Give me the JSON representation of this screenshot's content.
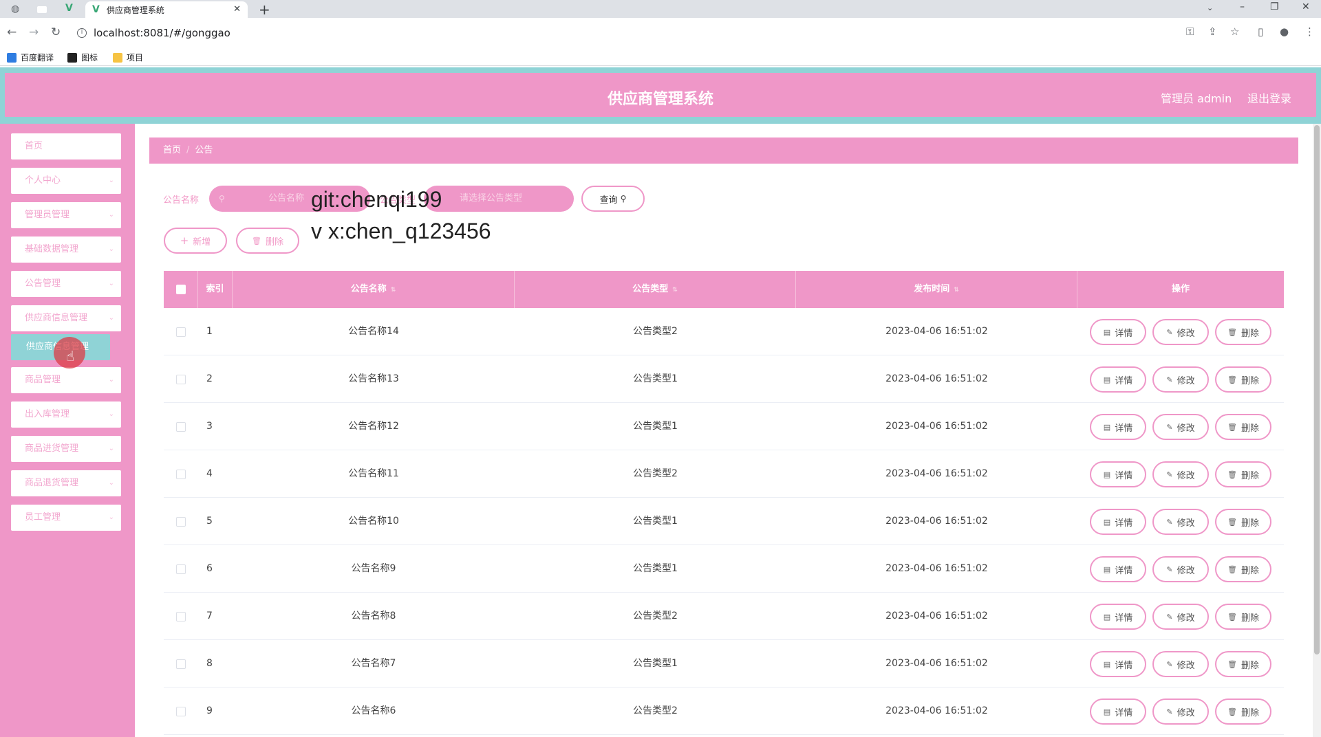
{
  "browser": {
    "tab_title": "供应商管理系统",
    "tab_close": "✕",
    "new_tab": "+",
    "url": "localhost:8081/#/gonggao",
    "bookmarks": [
      "百度翻译",
      "图标",
      "项目"
    ]
  },
  "header": {
    "title": "供应商管理系统",
    "admin": "管理员 admin",
    "logout": "退出登录"
  },
  "sidebar": {
    "items": [
      {
        "label": "首页",
        "has_chevron": false
      },
      {
        "label": "个人中心",
        "has_chevron": true
      },
      {
        "label": "管理员管理",
        "has_chevron": true
      },
      {
        "label": "基础数据管理",
        "has_chevron": true
      },
      {
        "label": "公告管理",
        "has_chevron": true
      },
      {
        "label": "供应商信息管理",
        "has_chevron": true
      },
      {
        "label": "商品管理",
        "has_chevron": true
      },
      {
        "label": "出入库管理",
        "has_chevron": true
      },
      {
        "label": "商品进货管理",
        "has_chevron": true
      },
      {
        "label": "商品退货管理",
        "has_chevron": true
      },
      {
        "label": "员工管理",
        "has_chevron": true
      }
    ],
    "popup_label": "供应商信息管理"
  },
  "breadcrumb": {
    "home": "首页",
    "current": "公告"
  },
  "search": {
    "name_label": "公告名称",
    "name_placeholder": "公告名称",
    "type_label": "公告类型",
    "type_placeholder": "请选择公告类型",
    "query_button": "查询"
  },
  "actions": {
    "add": "新增",
    "delete": "删除"
  },
  "watermark": {
    "line1": "git:chenqi199",
    "line2": "v x:chen_q123456"
  },
  "table": {
    "columns": [
      "索引",
      "公告名称",
      "公告类型",
      "发布时间",
      "操作"
    ],
    "row_buttons": {
      "detail": "详情",
      "edit": "修改",
      "delete": "删除"
    },
    "rows": [
      {
        "index": "1",
        "name": "公告名称14",
        "type": "公告类型2",
        "time": "2023-04-06 16:51:02"
      },
      {
        "index": "2",
        "name": "公告名称13",
        "type": "公告类型1",
        "time": "2023-04-06 16:51:02"
      },
      {
        "index": "3",
        "name": "公告名称12",
        "type": "公告类型1",
        "time": "2023-04-06 16:51:02"
      },
      {
        "index": "4",
        "name": "公告名称11",
        "type": "公告类型2",
        "time": "2023-04-06 16:51:02"
      },
      {
        "index": "5",
        "name": "公告名称10",
        "type": "公告类型1",
        "time": "2023-04-06 16:51:02"
      },
      {
        "index": "6",
        "name": "公告名称9",
        "type": "公告类型1",
        "time": "2023-04-06 16:51:02"
      },
      {
        "index": "7",
        "name": "公告名称8",
        "type": "公告类型2",
        "time": "2023-04-06 16:51:02"
      },
      {
        "index": "8",
        "name": "公告名称7",
        "type": "公告类型1",
        "time": "2023-04-06 16:51:02"
      },
      {
        "index": "9",
        "name": "公告名称6",
        "type": "公告类型2",
        "time": "2023-04-06 16:51:02"
      }
    ]
  },
  "colors": {
    "primary": "#ef97c8",
    "accent": "#8fd3d6"
  }
}
